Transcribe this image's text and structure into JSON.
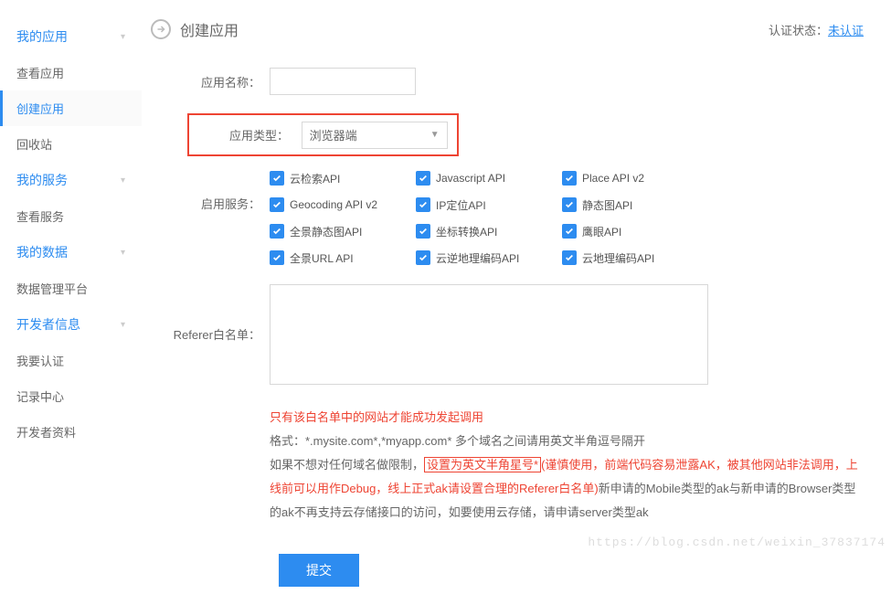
{
  "sidebar": {
    "groups": [
      {
        "title": "我的应用",
        "items": [
          {
            "label": "查看应用",
            "active": false
          },
          {
            "label": "创建应用",
            "active": true
          },
          {
            "label": "回收站",
            "active": false
          }
        ]
      },
      {
        "title": "我的服务",
        "items": [
          {
            "label": "查看服务",
            "active": false
          }
        ]
      },
      {
        "title": "我的数据",
        "items": [
          {
            "label": "数据管理平台",
            "active": false
          }
        ]
      },
      {
        "title": "开发者信息",
        "items": [
          {
            "label": "我要认证",
            "active": false
          },
          {
            "label": "记录中心",
            "active": false
          },
          {
            "label": "开发者资料",
            "active": false
          }
        ]
      }
    ]
  },
  "header": {
    "title": "创建应用",
    "auth_label": "认证状态：",
    "auth_value": "未认证"
  },
  "form": {
    "app_name_label": "应用名称：",
    "app_type_label": "应用类型：",
    "app_type_value": "浏览器端",
    "services_label": "启用服务：",
    "services": [
      "云检索API",
      "Javascript API",
      "Place API v2",
      "Geocoding API v2",
      "IP定位API",
      "静态图API",
      "全景静态图API",
      "坐标转换API",
      "鹰眼API",
      "全景URL API",
      "云逆地理编码API",
      "云地理编码API"
    ],
    "referer_label": "Referer白名单：",
    "help": {
      "line1": "只有该白名单中的网站才能成功发起调用",
      "line2": "格式：*.mysite.com*,*myapp.com* 多个域名之间请用英文半角逗号隔开",
      "line3a": "如果不想对任何域名做限制，",
      "line3b": "设置为英文半角星号*",
      "line3c": "(谨慎使用，前端代码容易泄露AK，被其他网站非法调用，上线前可以用作Debug，线上正式ak请设置合理的Referer白名单)",
      "line3d": "新申请的Mobile类型的ak与新申请的Browser类型的ak不再支持云存储接口的访问，如要使用云存储，请申请server类型ak"
    },
    "submit_label": "提交"
  },
  "watermark": "https://blog.csdn.net/weixin_37837174"
}
